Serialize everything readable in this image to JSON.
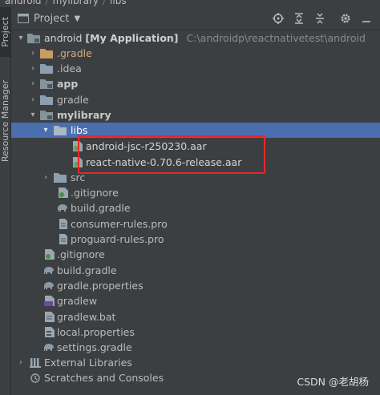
{
  "breadcrumb": {
    "items": [
      "android",
      "mylibrary",
      "libs"
    ]
  },
  "side_tabs": {
    "project": "Project",
    "resource_manager": "Resource Manager"
  },
  "header": {
    "title": "Project",
    "tools": [
      "locate-icon",
      "expand-all-icon",
      "collapse-all-icon",
      "settings-icon",
      "hide-icon"
    ]
  },
  "tree": {
    "root_name": "android",
    "root_module": "[My Application]",
    "root_path": "C:\\androidp\\reactnativetest\\android",
    "gradle_dir": ".gradle",
    "idea_dir": ".idea",
    "app_dir": "app",
    "gradle_folder": "gradle",
    "mylibrary_dir": "mylibrary",
    "libs_dir": "libs",
    "aar_1": "android-jsc-r250230.aar",
    "aar_2": "react-native-0.70.6-release.aar",
    "src_dir": "src",
    "lib_gitignore": ".gitignore",
    "lib_build_gradle": "build.gradle",
    "consumer_rules": "consumer-rules.pro",
    "proguard_rules": "proguard-rules.pro",
    "root_gitignore": ".gitignore",
    "root_build_gradle": "build.gradle",
    "gradle_properties": "gradle.properties",
    "gradlew": "gradlew",
    "gradlew_bat": "gradlew.bat",
    "local_properties": "local.properties",
    "settings_gradle": "settings.gradle",
    "external_libraries": "External Libraries",
    "scratches": "Scratches and Consoles"
  },
  "watermark": "CSDN @老胡杨",
  "colors": {
    "background": "#3c3f41",
    "selection": "#4b6eaf",
    "highlight_box": "#e8262a",
    "folder": "#8c9fb0",
    "module_folder": "#87939a"
  }
}
